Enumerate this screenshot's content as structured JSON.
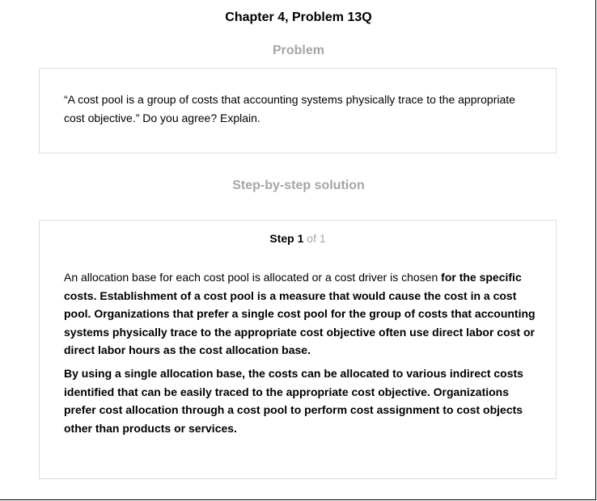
{
  "header": {
    "title": "Chapter 4, Problem 13Q"
  },
  "problem": {
    "heading": "Problem",
    "text": "“A cost pool is a group of costs that accounting systems physically trace to the appropriate cost objective.” Do you agree? Explain."
  },
  "solution": {
    "heading": "Step-by-step solution",
    "step": {
      "word": "Step",
      "number": "1",
      "of_text": "of 1"
    },
    "paragraph1": {
      "normal_part": "An allocation base for each cost pool is allocated or a cost driver is chosen ",
      "bold_part": "for the specific costs. Establishment of a cost pool is a measure that would cause the cost in a cost pool. Organizations that prefer a single cost pool for the group of costs that accounting systems physically trace to the appropriate cost objective often use direct labor cost or direct labor hours as the cost allocation base."
    },
    "paragraph2": "By using a single allocation base, the costs can be allocated to various indirect costs identified that can be easily traced to the appropriate cost objective. Organizations prefer cost allocation through a cost pool to perform cost assignment to cost objects other than products or services."
  },
  "colors": {
    "heading_gray": "#a6a6a6",
    "box_border": "#dcdcdc",
    "text": "#000000"
  }
}
